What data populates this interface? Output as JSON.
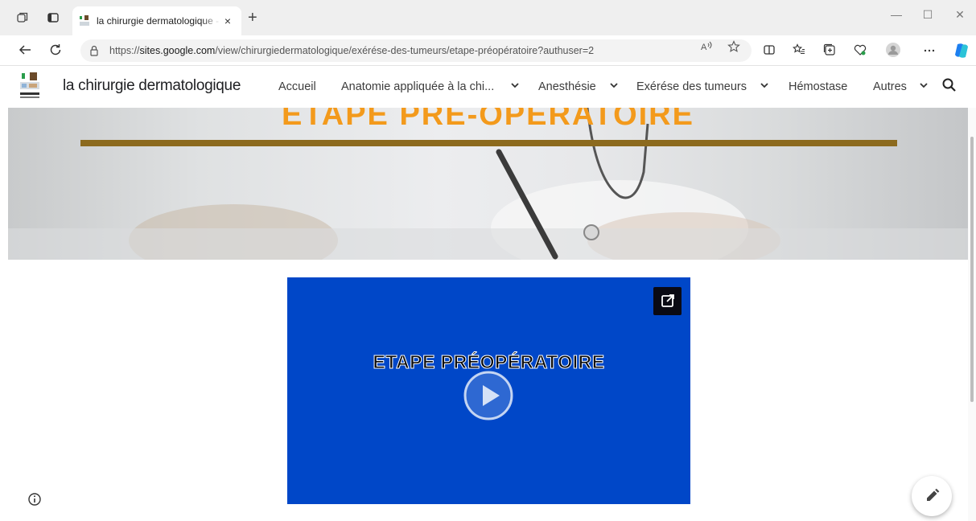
{
  "browser": {
    "tab_title": "la chirurgie dermatologique - Éta",
    "tab_close": "×",
    "new_tab": "+",
    "url_prefix": "https://",
    "url_host": "sites.google.com",
    "url_path": "/view/chirurgiedermatologique/exérése-des-tumeurs/etape-préopératoire?authuser=2",
    "window_controls": {
      "minimize": "—",
      "maximize": "☐",
      "close": "✕"
    },
    "icons": [
      "workspaces-icon",
      "tab-actions-icon",
      "back-icon",
      "refresh-icon",
      "lock-icon",
      "read-aloud-icon",
      "favorite-icon",
      "split-screen-icon",
      "favorites-icon",
      "collections-icon",
      "browser-essentials-icon",
      "profile-icon",
      "more-icon",
      "copilot-icon"
    ]
  },
  "site": {
    "title": "la chirurgie dermatologique",
    "nav": [
      {
        "label": "Accueil",
        "has_dropdown": false
      },
      {
        "label": "Anatomie appliquée à la chi...",
        "has_dropdown": true
      },
      {
        "label": "Anesthésie",
        "has_dropdown": true
      },
      {
        "label": "Exérése des tumeurs",
        "has_dropdown": true
      },
      {
        "label": "Hémostase",
        "has_dropdown": false
      },
      {
        "label": "Autres",
        "has_dropdown": true
      }
    ],
    "chevron": "⌄"
  },
  "banner": {
    "title": "ETAPE PRE-OPERATOIRE",
    "title_color": "#f39a1c",
    "rule_color": "#8c6a1e"
  },
  "video": {
    "title": "ETAPE PRÉOPÉRATOIRE",
    "background_color": "#0047c8"
  },
  "colors": {
    "accent": "#0047c8"
  }
}
